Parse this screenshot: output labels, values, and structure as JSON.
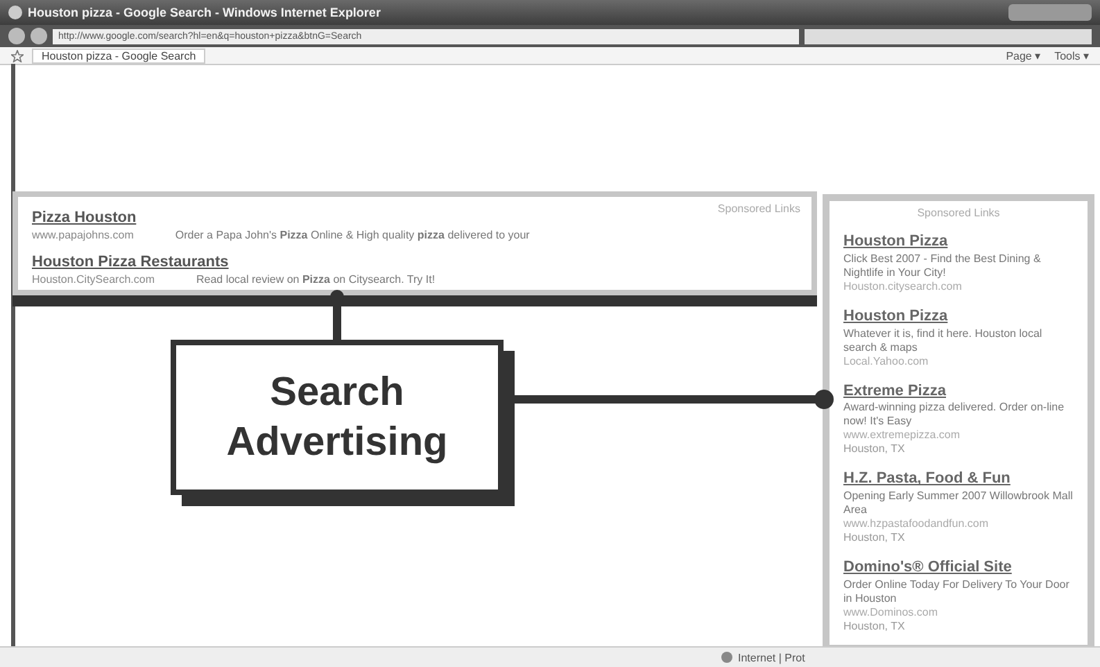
{
  "window": {
    "title": "Houston pizza - Google Search - Windows Internet Explorer"
  },
  "address_bar": {
    "value": "http://www.google.com/search?hl=en&q=houston+pizza&btnG=Search"
  },
  "tab": {
    "label": "Houston pizza - Google Search"
  },
  "toolbar": [
    "Page ▾",
    "Tools ▾"
  ],
  "top_ads": {
    "label": "Sponsored Links",
    "ads": [
      {
        "title": "Pizza Houston",
        "url": "www.papajohns.com",
        "text": "Order a Papa John's **Pizza** Online & High quality **pizza** delivered to your"
      },
      {
        "title": "Houston Pizza Restaurants",
        "url": "Houston.CitySearch.com",
        "text": "Read local review on **Pizza** on Citysearch. Try It!"
      }
    ]
  },
  "side_ads": {
    "label": "Sponsored Links",
    "ads": [
      {
        "title": "Houston Pizza",
        "text": "Click Best 2007 - Find the Best Dining & Nightlife in Your City!",
        "url": "Houston.citysearch.com"
      },
      {
        "title": "Houston Pizza",
        "text": "Whatever it is, find it here. Houston local search & maps",
        "url": "Local.Yahoo.com"
      },
      {
        "title": "Extreme Pizza",
        "text": "Award-winning pizza delivered. Order on-line now! It's Easy",
        "url": "www.extremepizza.com",
        "location": "Houston, TX"
      },
      {
        "title": "H.Z. Pasta, Food & Fun",
        "text": "Opening Early Summer 2007 Willowbrook Mall Area",
        "url": "www.hzpastafoodandfun.com",
        "location": "Houston, TX"
      },
      {
        "title": "Domino's® Official Site",
        "text": "Order Online Today For Delivery To Your Door in Houston",
        "url": "www.Dominos.com",
        "location": "Houston, TX"
      }
    ]
  },
  "callout": {
    "text": "Search Advertising"
  },
  "status_bar": {
    "zone": "Internet | Prot"
  }
}
